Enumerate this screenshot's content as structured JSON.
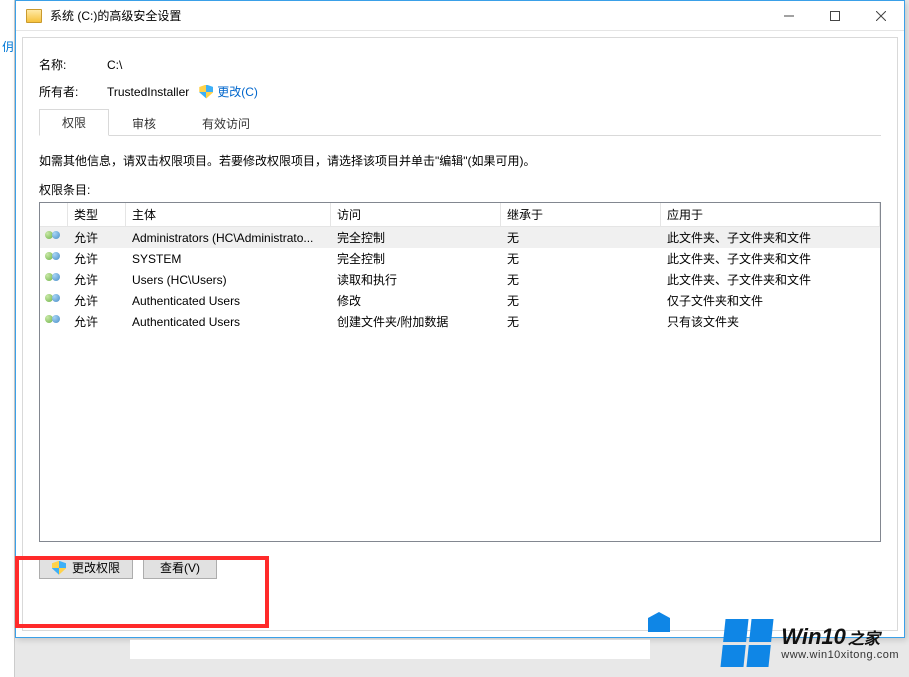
{
  "window": {
    "title": "系统 (C:)的高级安全设置"
  },
  "info": {
    "name_label": "名称:",
    "name_value": "C:\\",
    "owner_label": "所有者:",
    "owner_value": "TrustedInstaller",
    "change_link": "更改(C)"
  },
  "tabs": [
    {
      "label": "权限",
      "active": true
    },
    {
      "label": "审核",
      "active": false
    },
    {
      "label": "有效访问",
      "active": false
    }
  ],
  "instruction": "如需其他信息，请双击权限项目。若要修改权限项目，请选择该项目并单击\"编辑\"(如果可用)。",
  "section_label": "权限条目:",
  "columns": {
    "type": "类型",
    "principal": "主体",
    "access": "访问",
    "inherit": "继承于",
    "applies": "应用于"
  },
  "entries": [
    {
      "type": "允许",
      "principal": "Administrators (HC\\Administrato...",
      "access": "完全控制",
      "inherit": "无",
      "applies": "此文件夹、子文件夹和文件"
    },
    {
      "type": "允许",
      "principal": "SYSTEM",
      "access": "完全控制",
      "inherit": "无",
      "applies": "此文件夹、子文件夹和文件"
    },
    {
      "type": "允许",
      "principal": "Users (HC\\Users)",
      "access": "读取和执行",
      "inherit": "无",
      "applies": "此文件夹、子文件夹和文件"
    },
    {
      "type": "允许",
      "principal": "Authenticated Users",
      "access": "修改",
      "inherit": "无",
      "applies": "仅子文件夹和文件"
    },
    {
      "type": "允许",
      "principal": "Authenticated Users",
      "access": "创建文件夹/附加数据",
      "inherit": "无",
      "applies": "只有该文件夹"
    }
  ],
  "buttons": {
    "change_perm": "更改权限",
    "view": "查看(V)"
  },
  "watermark": {
    "brand": "Win10",
    "suffix": "之家",
    "url": "www.win10xitong.com"
  },
  "sliver_char": "仴"
}
